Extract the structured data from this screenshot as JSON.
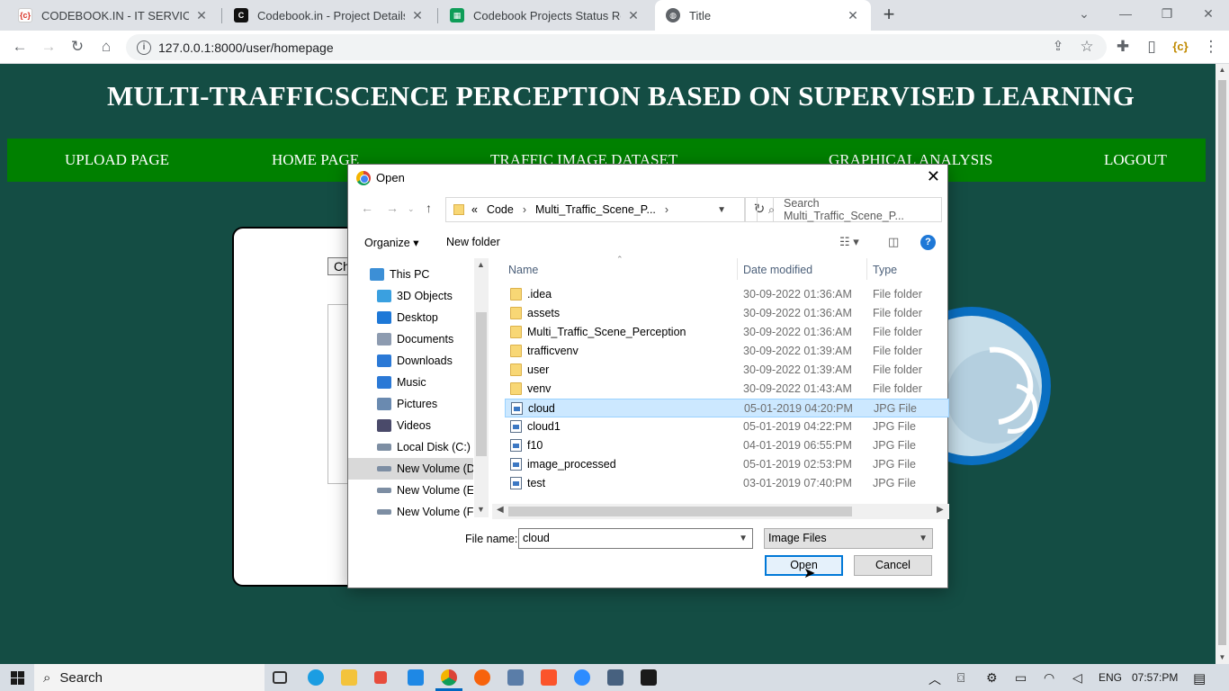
{
  "browser": {
    "tabs": [
      {
        "title": "CODEBOOK.IN - IT SERVICES",
        "fav_color": "#ffffff",
        "fav_text": "{c}"
      },
      {
        "title": "Codebook.in - Project Details",
        "fav_color": "#111111",
        "fav_text": "C"
      },
      {
        "title": "Codebook Projects Status Report",
        "fav_color": "#0f9d58",
        "fav_text": "▦"
      },
      {
        "title": "Title",
        "fav_color": "#5f6368",
        "fav_text": "◍"
      }
    ],
    "url": "127.0.0.1:8000/user/homepage"
  },
  "page": {
    "title": "MULTI-TRAFFICSCENCE PERCEPTION BASED ON SUPERVISED LEARNING",
    "nav": [
      "UPLOAD PAGE",
      "HOME PAGE",
      "TRAFFIC IMAGE DATASET",
      "GRAPHICAL ANALYSIS",
      "LOGOUT"
    ],
    "choose_button": "Ch",
    "bg_color": "#144d44",
    "nav_color": "#008000"
  },
  "dialog": {
    "title": "Open",
    "breadcrumb": [
      "«",
      "Code",
      "Multi_Traffic_Scene_P..."
    ],
    "search_placeholder": "Search Multi_Traffic_Scene_P...",
    "organize": "Organize ▾",
    "new_folder": "New folder",
    "nav_items": [
      {
        "label": "This PC",
        "icon": "pc-icon",
        "color": "#3c8fd6"
      },
      {
        "label": "3D Objects",
        "icon": "cube-icon",
        "color": "#3aa0e0"
      },
      {
        "label": "Desktop",
        "icon": "desktop-icon",
        "color": "#1e78d7"
      },
      {
        "label": "Documents",
        "icon": "documents-icon",
        "color": "#8d9bb0"
      },
      {
        "label": "Downloads",
        "icon": "download-icon",
        "color": "#2b79d6"
      },
      {
        "label": "Music",
        "icon": "music-icon",
        "color": "#2b79d6"
      },
      {
        "label": "Pictures",
        "icon": "pictures-icon",
        "color": "#6a8ab0"
      },
      {
        "label": "Videos",
        "icon": "videos-icon",
        "color": "#4a4a6a"
      },
      {
        "label": "Local Disk (C:)",
        "icon": "drive-icon",
        "color": "#7d8ea3"
      },
      {
        "label": "New Volume (D:",
        "icon": "drive-icon",
        "color": "#7d8ea3"
      },
      {
        "label": "New Volume (E:)",
        "icon": "drive-icon",
        "color": "#7d8ea3"
      },
      {
        "label": "New Volume (F:)",
        "icon": "drive-icon",
        "color": "#7d8ea3"
      }
    ],
    "selected_nav_index": 9,
    "columns": [
      "Name",
      "Date modified",
      "Type"
    ],
    "files": [
      {
        "name": ".idea",
        "date": "30-09-2022 01:36:AM",
        "type": "File folder",
        "kind": "folder"
      },
      {
        "name": "assets",
        "date": "30-09-2022 01:36:AM",
        "type": "File folder",
        "kind": "folder"
      },
      {
        "name": "Multi_Traffic_Scene_Perception",
        "date": "30-09-2022 01:36:AM",
        "type": "File folder",
        "kind": "folder"
      },
      {
        "name": "trafficvenv",
        "date": "30-09-2022 01:39:AM",
        "type": "File folder",
        "kind": "folder"
      },
      {
        "name": "user",
        "date": "30-09-2022 01:39:AM",
        "type": "File folder",
        "kind": "folder"
      },
      {
        "name": "venv",
        "date": "30-09-2022 01:43:AM",
        "type": "File folder",
        "kind": "folder"
      },
      {
        "name": "cloud",
        "date": "05-01-2019 04:20:PM",
        "type": "JPG File",
        "kind": "file"
      },
      {
        "name": "cloud1",
        "date": "05-01-2019 04:22:PM",
        "type": "JPG File",
        "kind": "file"
      },
      {
        "name": "f10",
        "date": "04-01-2019 06:55:PM",
        "type": "JPG File",
        "kind": "file"
      },
      {
        "name": "image_processed",
        "date": "05-01-2019 02:53:PM",
        "type": "JPG File",
        "kind": "file"
      },
      {
        "name": "test",
        "date": "03-01-2019 07:40:PM",
        "type": "JPG File",
        "kind": "file"
      }
    ],
    "selected_file_index": 6,
    "file_name_label": "File name:",
    "file_name_value": "cloud",
    "file_type": "Image Files",
    "open_label": "Open",
    "cancel_label": "Cancel"
  },
  "taskbar": {
    "search_label": "Search",
    "language": "ENG",
    "time": "07:57:PM"
  }
}
